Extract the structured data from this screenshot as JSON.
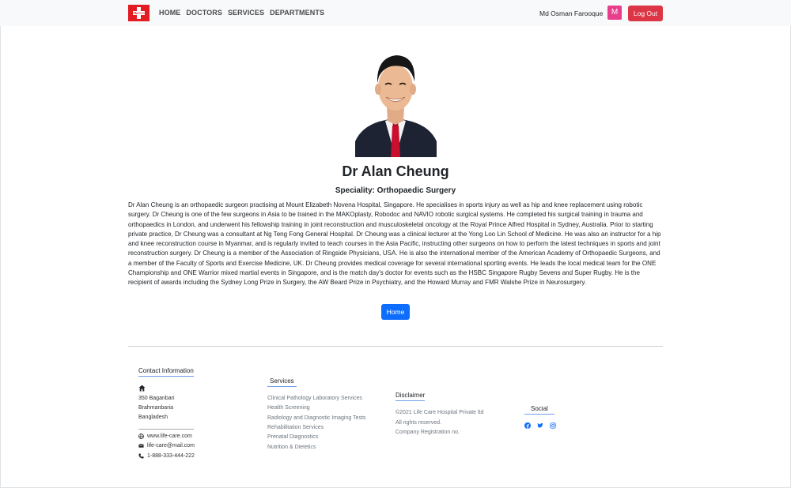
{
  "navbar": {
    "links": [
      "HOME",
      "DOCTORS",
      "SERVICES",
      "DEPARTMENTS"
    ],
    "user_name": "Md Osman Farooque",
    "avatar_letter": "M",
    "logout_label": "Log Out"
  },
  "doctor": {
    "name": "Dr Alan Cheung",
    "speciality": "Speciality: Orthopaedic Surgery",
    "bio": "Dr Alan Cheung is an orthopaedic surgeon practising at Mount Elizabeth Novena Hospital, Singapore. He specialises in sports injury as well as hip and knee replacement using robotic surgery. Dr Cheung is one of the few surgeons in Asia to be trained in the MAKOplasty, Robodoc and NAVIO robotic surgical systems. He completed his surgical training in trauma and orthopaedics in London, and underwent his fellowship training in joint reconstruction and musculoskeletal oncology at the Royal Prince Alfred Hospital in Sydney, Australia. Prior to starting private practice, Dr Cheung was a consultant at Ng Teng Fong General Hospital. Dr Cheung was a clinical lecturer at the Yong Loo Lin School of Medicine. He was also an instructor for a hip and knee reconstruction course in Myanmar, and is regularly invited to teach courses in the Asia Pacific, instructing other surgeons on how to perform the latest techniques in sports and joint reconstruction surgery. Dr Cheung is a member of the Association of Ringside Physicians, USA. He is also the international member of the American Academy of Orthopaedic Surgeons, and a member of the Faculty of Sports and Exercise Medicine, UK. Dr Cheung provides medical coverage for several international sporting events. He leads the local medical team for the ONE Championship and ONE Warrior mixed martial events in Singapore, and is the match day's doctor for events such as the HSBC Singapore Rugby Sevens and Super Rugby. He is the recipient of awards including the Sydney Long Prize in Surgery, the AW Beard Prize in Psychiatry, and the Howard Murray and FMR Walshe Prize in Neurosurgery.",
    "home_button": "Home"
  },
  "footer": {
    "contact": {
      "heading": "Contact Information",
      "address": [
        "350 Baganbari",
        "Brahmanbaria",
        "Bangladesh"
      ],
      "website": "www.life-care.com",
      "email": "life-care@mail.com",
      "phone": "1-888-333-444-222"
    },
    "services": {
      "heading": "Services",
      "items": [
        "Clinical Pathology Laboratory Services",
        "Health Screening",
        "Radiology and Diagnostic Imaging Tests",
        "Rehabilitation Services",
        "Prenatal Diagnostics",
        "Nutrition & Dietetics"
      ]
    },
    "disclaimer": {
      "heading": "Disclaimer",
      "lines": [
        "©2021 Life Care Hospital Private ltd",
        "All rights reserved.",
        "Company Registration no."
      ]
    },
    "social": {
      "heading": "Social",
      "icons": [
        "facebook-icon",
        "twitter-icon",
        "instagram-icon"
      ]
    }
  },
  "colors": {
    "brand_red": "#e31b23",
    "logout": "#dc3545",
    "avatar": "#e83e8c",
    "primary": "#0d6efd",
    "social": "#0d6efd"
  }
}
